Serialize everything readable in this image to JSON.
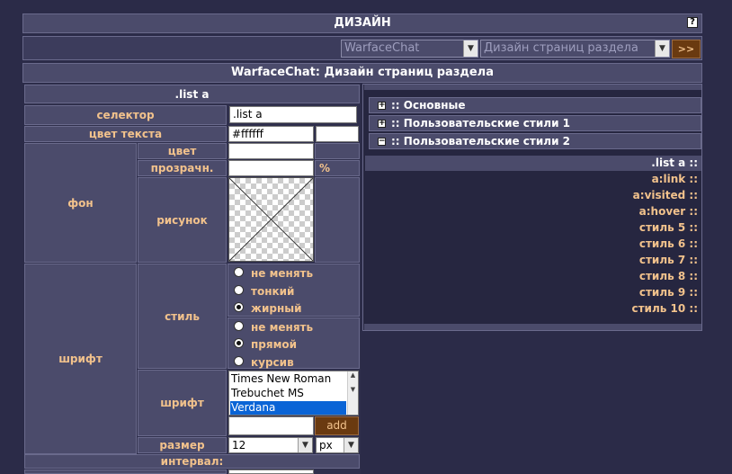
{
  "header": {
    "title": "ДИЗАЙН",
    "help": "?"
  },
  "toolbar": {
    "chat_select": "WarfaceChat",
    "section_select": "Дизайн страниц раздела",
    "go_label": ">>"
  },
  "subtitle": "WarfaceChat: Дизайн страниц раздела",
  "editor": {
    "selector_title": ".list a",
    "selector_label": "селектор",
    "selector_value": ".list a",
    "text_color_label": "цвет текста",
    "text_color_value": "#ffffff",
    "bg_label": "фон",
    "bg_color_label": "цвет",
    "bg_opacity_label": "прозрачн.",
    "percent": "%",
    "bg_image_label": "рисунок",
    "font_label": "шрифт",
    "style_label": "стиль",
    "weight_options": [
      "не менять",
      "тонкий",
      "жирный"
    ],
    "weight_selected": 2,
    "italic_options": [
      "не менять",
      "прямой",
      "курсив"
    ],
    "italic_selected": 1,
    "font_list_label": "шрифт",
    "fonts": [
      "Times New Roman",
      "Trebuchet MS",
      "Verdana"
    ],
    "font_selected": "Verdana",
    "add_label": "add",
    "size_label": "размер",
    "size_value": "12",
    "unit_value": "px",
    "interval_label": "интервал:"
  },
  "tree": {
    "items": [
      {
        "label": ":: Основные",
        "state": "+"
      },
      {
        "label": ":: Пользовательские стили 1",
        "state": "+"
      },
      {
        "label": ":: Пользовательские стили 2",
        "state": "−"
      }
    ],
    "styles": [
      ".list a ::",
      "a:link ::",
      "a:visited ::",
      "a:hover ::",
      "стиль 5 ::",
      "стиль 6 ::",
      "стиль 7 ::",
      "стиль 8 ::",
      "стиль 9 ::",
      "стиль 10 ::"
    ],
    "selected_style": ".list a ::"
  }
}
